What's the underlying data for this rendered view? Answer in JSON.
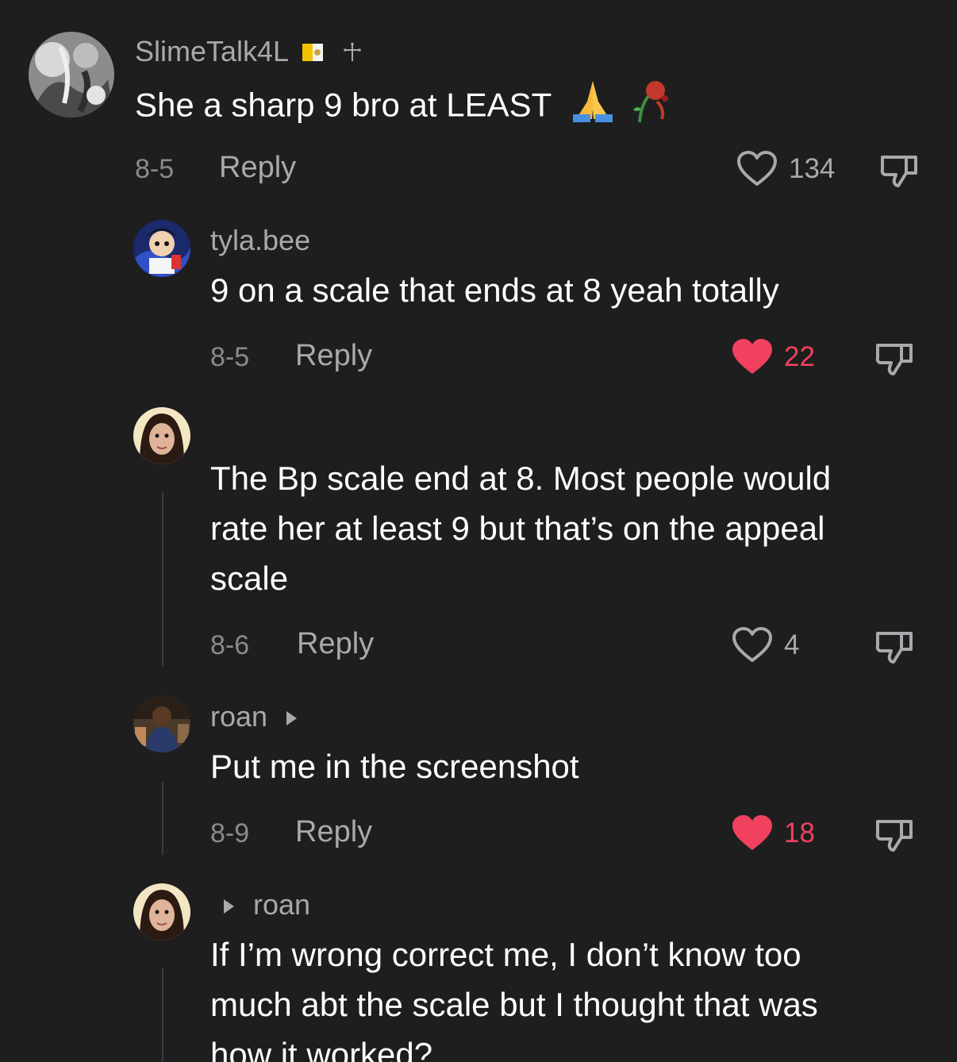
{
  "colors": {
    "background": "#1e1e1f",
    "text": "#ffffff",
    "muted": "#a9a9ad",
    "like_active": "#f0415e"
  },
  "comments": [
    {
      "username": "SlimeTalk4L",
      "badges": [
        "vatican-flag-icon",
        "cross-icon"
      ],
      "text": "She a sharp 9 bro at LEAST",
      "emojis": [
        "praying-hands-icon",
        "wilted-rose-icon"
      ],
      "date": "8-5",
      "reply_label": "Reply",
      "likes": "134",
      "liked": false
    },
    {
      "username": "tyla.bee",
      "text": "9 on a scale that ends at 8 yeah totally",
      "date": "8-5",
      "reply_label": "Reply",
      "likes": "22",
      "liked": true
    },
    {
      "username": "",
      "lines": [
        "The Bp scale end at 8. Most people would",
        "rate her at least 9 but that’s on the appeal",
        "scale"
      ],
      "date": "8-6",
      "reply_label": "Reply",
      "likes": "4",
      "liked": false
    },
    {
      "username": "roan",
      "text": "Put me in the screenshot",
      "date": "8-9",
      "reply_label": "Reply",
      "likes": "18",
      "liked": true
    },
    {
      "reply_to": "roan",
      "lines": [
        "If I’m wrong correct me, I don’t know too",
        "much abt the scale but I thought that was",
        "how it worked?"
      ]
    }
  ]
}
